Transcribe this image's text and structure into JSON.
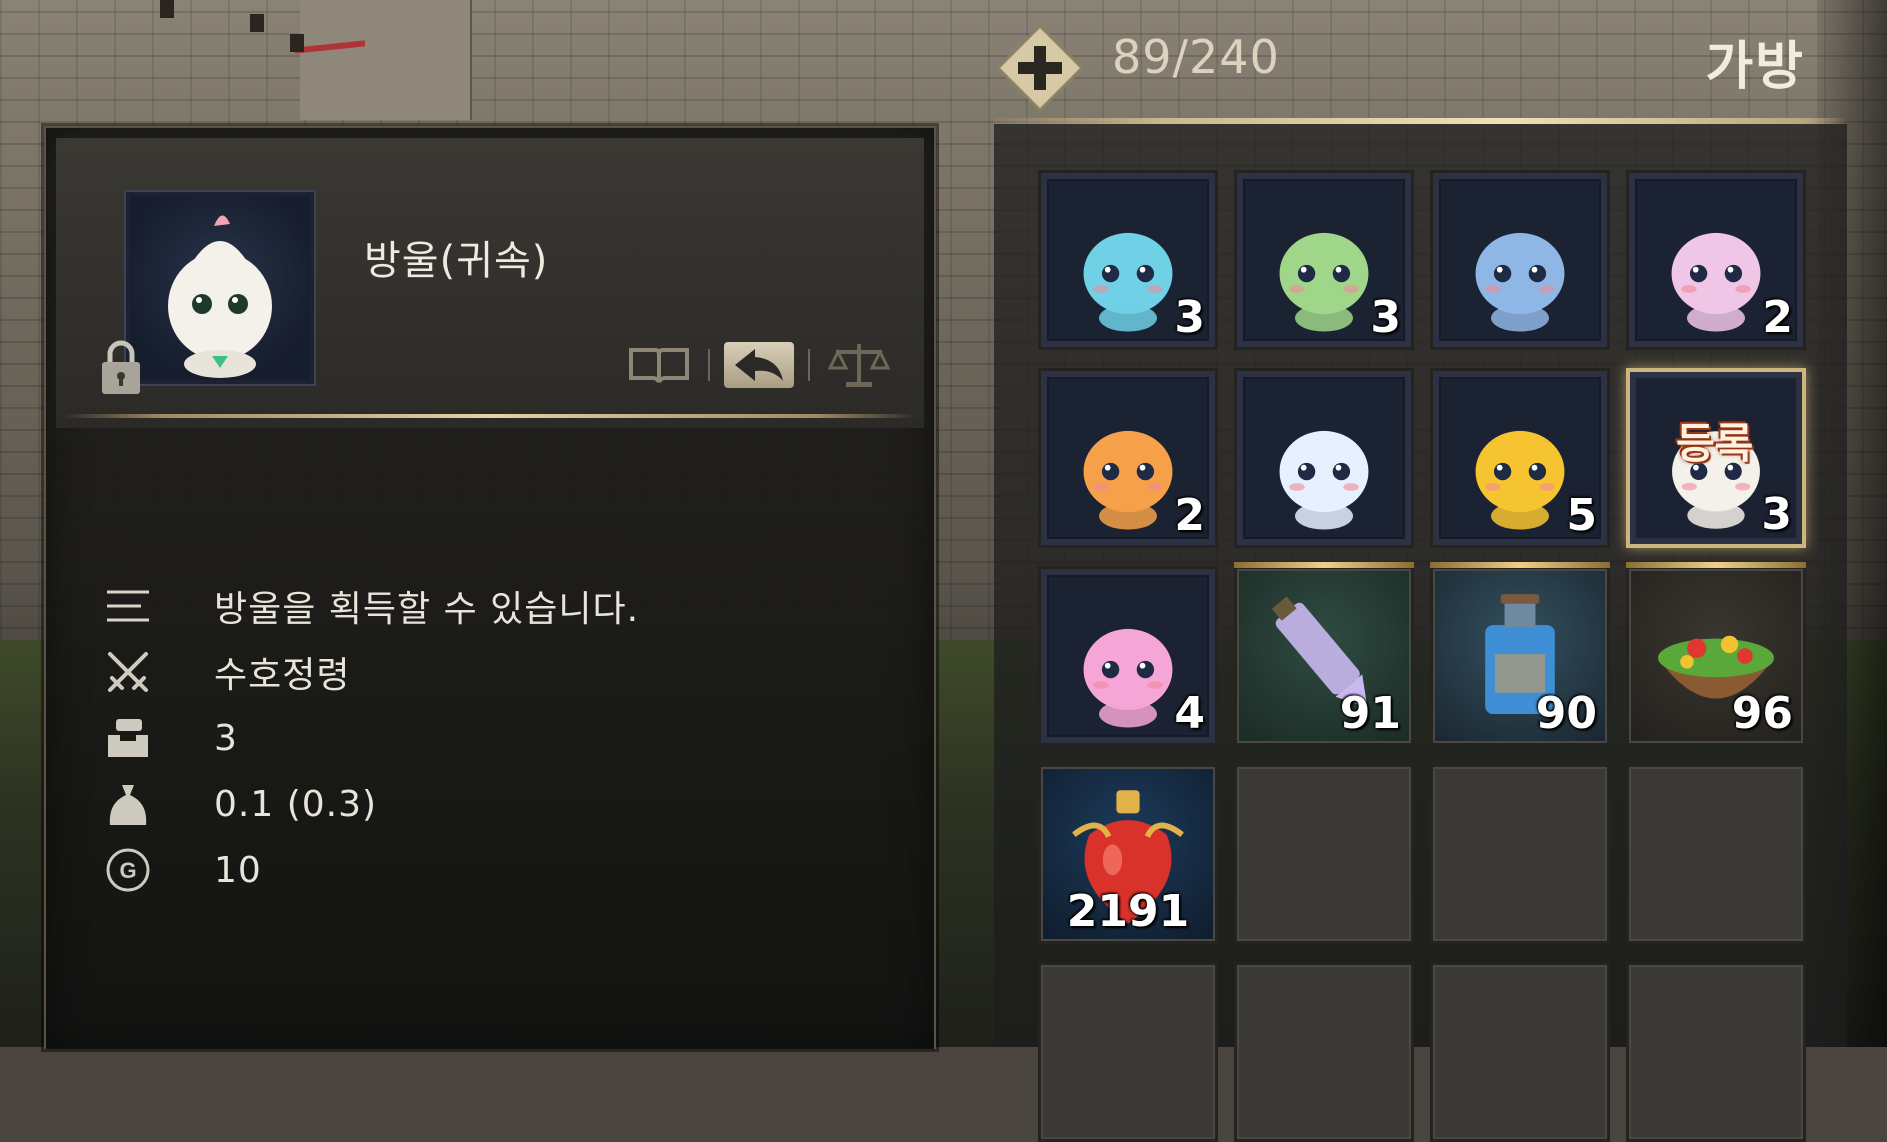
{
  "bag": {
    "title": "가방",
    "capacity": "89/240",
    "add_icon": "plus-icon",
    "slots": [
      {
        "name": "blue-fin-spirit",
        "qty": "3",
        "kind": "creature",
        "color": "#6fd0e6"
      },
      {
        "name": "green-leaf-spirit",
        "qty": "3",
        "kind": "creature",
        "color": "#9fd68a"
      },
      {
        "name": "blue-bunny-spirit",
        "qty": "",
        "kind": "creature",
        "color": "#8fb7e6"
      },
      {
        "name": "pink-crown-spirit",
        "qty": "2",
        "kind": "creature",
        "color": "#f0c6e6"
      },
      {
        "name": "orange-puffer-spirit",
        "qty": "2",
        "kind": "creature",
        "color": "#f6a14a"
      },
      {
        "name": "white-feather-spirit",
        "qty": "",
        "kind": "creature",
        "color": "#e6f0ff"
      },
      {
        "name": "yellow-chick-spirit",
        "qty": "5",
        "kind": "creature",
        "color": "#f7c431"
      },
      {
        "name": "white-bud-spirit",
        "qty": "3",
        "kind": "creature",
        "color": "#f4f0ea",
        "badge": "등록",
        "selected": true
      },
      {
        "name": "pink-ghost-spirit",
        "qty": "4",
        "kind": "creature",
        "color": "#f6a6d6"
      },
      {
        "name": "crystal-elixir",
        "qty": "91",
        "kind": "green",
        "color": "#c9b9f0"
      },
      {
        "name": "blue-potion",
        "qty": "90",
        "kind": "blue",
        "color": "#3f8fd6"
      },
      {
        "name": "salad-bowl",
        "qty": "96",
        "kind": "warm",
        "color": "#5aa83a"
      },
      {
        "name": "red-elixir",
        "qty": "2191",
        "kind": "crimson",
        "color": "#d8322a"
      },
      {
        "name": "empty-slot",
        "qty": "",
        "kind": "empty"
      },
      {
        "name": "empty-slot",
        "qty": "",
        "kind": "empty"
      },
      {
        "name": "empty-slot",
        "qty": "",
        "kind": "empty"
      },
      {
        "name": "empty-slot",
        "qty": "",
        "kind": "empty"
      },
      {
        "name": "empty-slot",
        "qty": "",
        "kind": "empty"
      },
      {
        "name": "empty-slot",
        "qty": "",
        "kind": "empty"
      },
      {
        "name": "empty-slot",
        "qty": "",
        "kind": "empty"
      }
    ]
  },
  "tooltip": {
    "item_name": "방울(귀속)",
    "lock_icon": "padlock-icon",
    "actions": [
      {
        "icon": "book-icon"
      },
      {
        "icon": "share-arrow-icon",
        "highlighted": true
      },
      {
        "icon": "scale-icon"
      }
    ],
    "details": [
      {
        "icon": "description-lines-icon",
        "text": "방울을 획득할 수 있습니다."
      },
      {
        "icon": "crossed-swords-icon",
        "text": "수호정령"
      },
      {
        "icon": "stack-count-icon",
        "text": "3"
      },
      {
        "icon": "weight-bag-icon",
        "text": "0.1  (0.3)"
      },
      {
        "icon": "gold-coin-icon",
        "text": "10"
      }
    ]
  },
  "colors": {
    "accent_gold": "#e6d3a4",
    "panel_bg": "#1c1b19",
    "text": "#e9e4da"
  }
}
